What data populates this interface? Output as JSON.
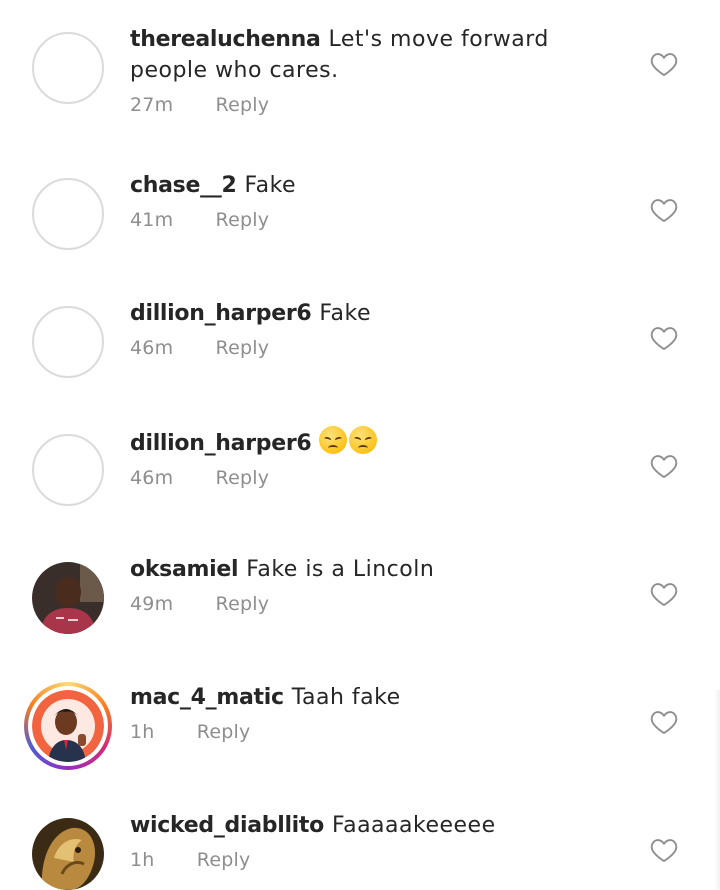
{
  "comments": [
    {
      "username": "therealuchenna",
      "text": "Let's move forward people who cares.",
      "time": "27m",
      "reply": "Reply"
    },
    {
      "username": "chase__2",
      "text": "Fake",
      "time": "41m",
      "reply": "Reply"
    },
    {
      "username": "dillion_harper6",
      "text": "Fake",
      "time": "46m",
      "reply": "Reply"
    },
    {
      "username": "dillion_harper6",
      "text": "",
      "emoji": [
        "disappointed-face",
        "disappointed-face"
      ],
      "time": "46m",
      "reply": "Reply"
    },
    {
      "username": "oksamiel",
      "text": "Fake is a Lincoln",
      "time": "49m",
      "reply": "Reply"
    },
    {
      "username": "mac_4_matic",
      "text": "Taah fake",
      "time": "1h",
      "reply": "Reply"
    },
    {
      "username": "wicked_diabllito",
      "text": "Faaaaakeeeee",
      "time": "1h",
      "reply": "Reply"
    }
  ],
  "icons": {
    "like": "heart-outline-icon"
  },
  "colors": {
    "text": "#262626",
    "meta": "#8e8e8e",
    "avatar_border": "#dbdbdb",
    "heart": "#8e8e8e"
  }
}
